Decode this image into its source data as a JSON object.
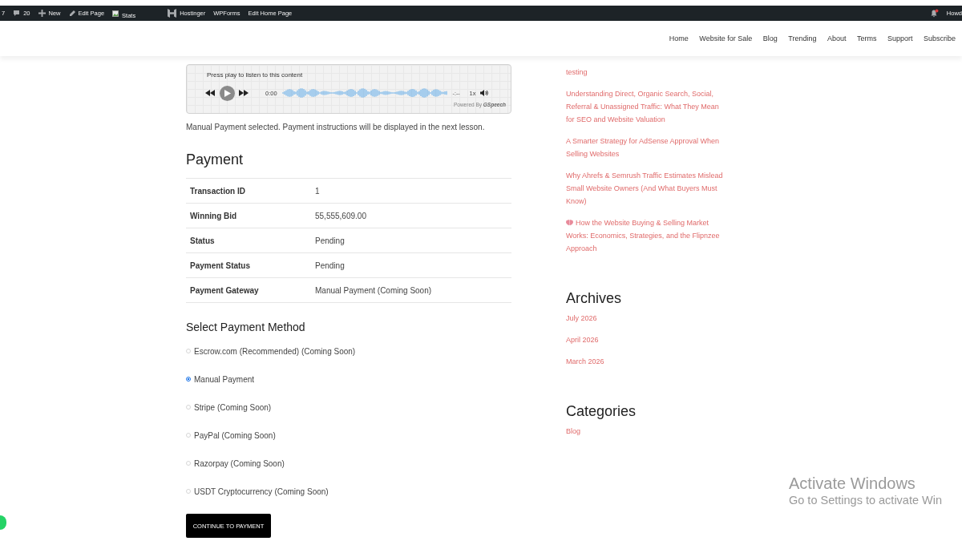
{
  "admin_bar": {
    "items": [
      {
        "kind": "text",
        "label": "7"
      },
      {
        "kind": "comments",
        "label": "20"
      },
      {
        "kind": "new",
        "label": "New"
      },
      {
        "kind": "edit",
        "label": "Edit Page"
      },
      {
        "kind": "image",
        "label": "Stats"
      },
      {
        "kind": "hostinger",
        "label": "Hostinger"
      },
      {
        "kind": "text",
        "label": "WPForms"
      },
      {
        "kind": "text",
        "label": "Edit Home Page"
      }
    ],
    "notifications": {
      "unread": true
    },
    "account": "Howd"
  },
  "nav": {
    "items": [
      "Home",
      "Website for Sale",
      "Blog",
      "Trending",
      "About",
      "Terms",
      "Support",
      "Subscribe"
    ]
  },
  "audio_player": {
    "prompt": "Press play to listen to this content",
    "time": "0:00",
    "duration": "-:--",
    "speed": "1x",
    "credit": "Powered By **GSpeech**"
  },
  "notice": "Manual Payment selected. Payment instructions will be displayed in the next lesson.",
  "payment": {
    "title": "Payment",
    "rows": [
      {
        "label": "Transaction ID",
        "value": "1"
      },
      {
        "label": "Winning Bid",
        "value": "55,555,609.00"
      },
      {
        "label": "Status",
        "value": "Pending"
      },
      {
        "label": "Payment Status",
        "value": "Pending"
      },
      {
        "label": "Payment Gateway",
        "value": "Manual Payment (Coming Soon)"
      }
    ]
  },
  "payment_method": {
    "title": "Select Payment Method",
    "options": [
      {
        "label": "Escrow.com (Recommended) (Coming Soon)",
        "selected": false
      },
      {
        "label": "Manual Payment",
        "selected": true
      },
      {
        "label": "Stripe (Coming Soon)",
        "selected": false
      },
      {
        "label": "PayPal (Coming Soon)",
        "selected": false
      },
      {
        "label": "Razorpay (Coming Soon)",
        "selected": false
      },
      {
        "label": "USDT Cryptocurrency (Coming Soon)",
        "selected": false
      }
    ],
    "button": "CONTINUE TO PAYMENT"
  },
  "sidebar": {
    "recent_posts": [
      {
        "kind": "plain",
        "title": "testing"
      },
      {
        "kind": "plain",
        "title": "Understanding Direct, Organic Search, Social, Referral & Unassigned Traffic: What They Mean for SEO and Website Valuation"
      },
      {
        "kind": "plain",
        "title": "A Smarter Strategy for AdSense Approval When Selling Websites"
      },
      {
        "kind": "plain",
        "title": "Why Ahrefs & Semrush Traffic Estimates Mislead Small Website Owners (And What Buyers Must Know)"
      },
      {
        "kind": "emoji",
        "title": "How the Website Buying & Selling Market Works: Economics, Strategies, and the Flipnzee Approach"
      }
    ],
    "archives": {
      "title": "Archives",
      "items": [
        "July 2026",
        "April 2026",
        "March 2026"
      ]
    },
    "categories": {
      "title": "Categories",
      "items": [
        "Blog"
      ]
    }
  },
  "activation_notice": {
    "title": "Activate Windows",
    "message": "Go to Settings to activate Win"
  }
}
